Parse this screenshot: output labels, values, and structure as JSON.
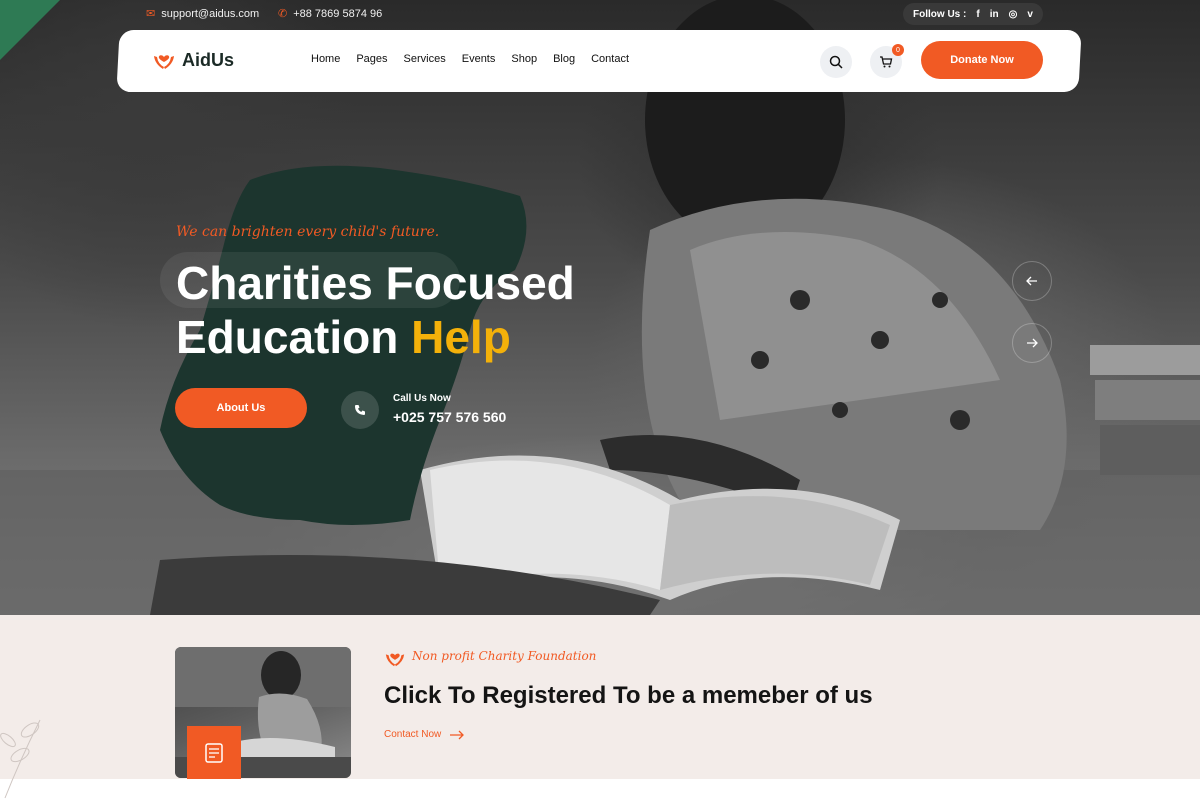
{
  "topbar": {
    "email": "support@aidus.com",
    "phone": "+88 7869 5874 96",
    "follow_label": "Follow Us :",
    "social_icons": [
      "facebook-icon",
      "linkedin-icon",
      "instagram-icon",
      "vimeo-icon"
    ],
    "social_glyphs": [
      "f",
      "in",
      "◎",
      "v"
    ]
  },
  "brand": {
    "name": "AidUs"
  },
  "nav": {
    "items": [
      "Home",
      "Pages",
      "Services",
      "Events",
      "Shop",
      "Blog",
      "Contact"
    ]
  },
  "header": {
    "cart_count": "0",
    "donate_label": "Donate Now"
  },
  "hero": {
    "tagline": "We can brighten every child's future.",
    "headline_line1": "Charities Focused",
    "headline_line2_main": "Education",
    "headline_line2_accent": "Help",
    "about_label": "About Us",
    "call_label": "Call Us Now",
    "call_number": "+025 757 576 560"
  },
  "cta": {
    "eyebrow": "Non profit Charity Foundation",
    "title": "Click To Registered To be a memeber of us",
    "link_label": "Contact Now"
  },
  "colors": {
    "accent": "#f15a24",
    "highlight": "#f4b10a",
    "hero_shape": "#1c352e",
    "section_bg": "#f3ece9",
    "corner_green": "#2e7a54"
  }
}
